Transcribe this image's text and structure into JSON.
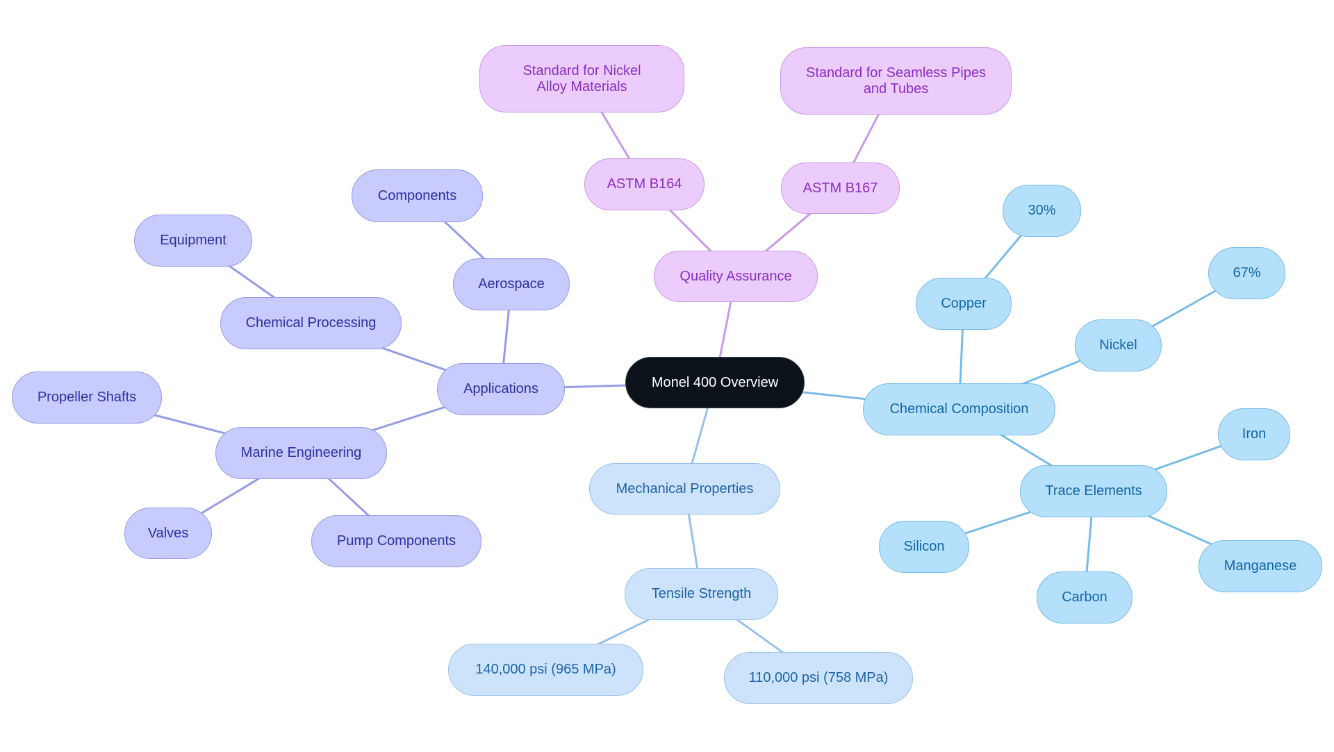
{
  "diagram": {
    "type": "mindmap",
    "root": "Monel 400 Overview",
    "colors": {
      "root": "#0b121a",
      "applications": "#c7cbfd",
      "quality_assurance": "#ebccfd",
      "mechanical_properties": "#cde3fb",
      "chemical_composition": "#b4e0fc"
    },
    "nodes": {
      "root": "Monel 400 Overview",
      "applications": "Applications",
      "aerospace": "Aerospace",
      "components": "Components",
      "chemical_processing": "Chemical Processing",
      "equipment": "Equipment",
      "marine_engineering": "Marine Engineering",
      "propeller_shafts": "Propeller Shafts",
      "valves": "Valves",
      "pump_components": "Pump Components",
      "quality_assurance": "Quality Assurance",
      "astm_b164": "ASTM B164",
      "std_nickel_alloy": "Standard for Nickel Alloy Materials",
      "astm_b167": "ASTM B167",
      "std_seamless": "Standard for Seamless Pipes and Tubes",
      "mechanical_properties": "Mechanical Properties",
      "tensile_strength": "Tensile Strength",
      "psi_140000": "140,000 psi (965 MPa)",
      "psi_110000": "110,000 psi (758 MPa)",
      "chemical_composition": "Chemical Composition",
      "copper": "Copper",
      "copper_pct": "30%",
      "nickel": "Nickel",
      "nickel_pct": "67%",
      "trace_elements": "Trace Elements",
      "iron": "Iron",
      "silicon": "Silicon",
      "carbon": "Carbon",
      "manganese": "Manganese"
    },
    "edges": [
      [
        "root",
        "applications"
      ],
      [
        "applications",
        "aerospace"
      ],
      [
        "aerospace",
        "components"
      ],
      [
        "applications",
        "chemical_processing"
      ],
      [
        "chemical_processing",
        "equipment"
      ],
      [
        "applications",
        "marine_engineering"
      ],
      [
        "marine_engineering",
        "propeller_shafts"
      ],
      [
        "marine_engineering",
        "valves"
      ],
      [
        "marine_engineering",
        "pump_components"
      ],
      [
        "root",
        "quality_assurance"
      ],
      [
        "quality_assurance",
        "astm_b164"
      ],
      [
        "astm_b164",
        "std_nickel_alloy"
      ],
      [
        "quality_assurance",
        "astm_b167"
      ],
      [
        "astm_b167",
        "std_seamless"
      ],
      [
        "root",
        "mechanical_properties"
      ],
      [
        "mechanical_properties",
        "tensile_strength"
      ],
      [
        "tensile_strength",
        "psi_140000"
      ],
      [
        "tensile_strength",
        "psi_110000"
      ],
      [
        "root",
        "chemical_composition"
      ],
      [
        "chemical_composition",
        "copper"
      ],
      [
        "copper",
        "copper_pct"
      ],
      [
        "chemical_composition",
        "nickel"
      ],
      [
        "nickel",
        "nickel_pct"
      ],
      [
        "chemical_composition",
        "trace_elements"
      ],
      [
        "trace_elements",
        "iron"
      ],
      [
        "trace_elements",
        "silicon"
      ],
      [
        "trace_elements",
        "carbon"
      ],
      [
        "trace_elements",
        "manganese"
      ]
    ]
  }
}
